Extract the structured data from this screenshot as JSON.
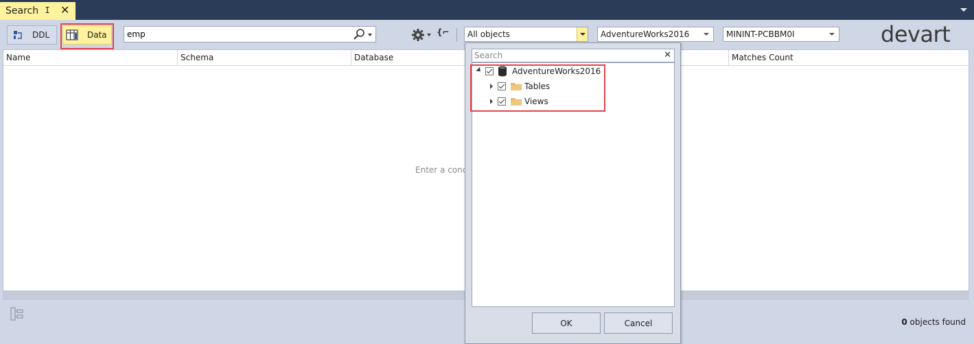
{
  "window": {
    "tab_title": "Search",
    "pin_glyph": "ⵊ",
    "close_glyph": "✕"
  },
  "toolbar": {
    "ddl_label": "DDL",
    "data_label": "Data",
    "search_value": "emp",
    "object_filter": "All objects",
    "database": "AdventureWorks2016",
    "server": "MININT-PCBBM0I",
    "brace_glyph": "{⌐"
  },
  "brand": {
    "logo_text": "devart"
  },
  "grid": {
    "columns": [
      "Name",
      "Schema",
      "Database",
      "Matches Count"
    ],
    "empty_message": "Enter a cond"
  },
  "popup": {
    "search_placeholder": "Search",
    "clear_glyph": "✕",
    "tree": [
      {
        "label": "AdventureWorks2016",
        "expanded": true,
        "checked": true,
        "icon": "database-icon"
      },
      {
        "label": "Tables",
        "expanded": false,
        "checked": true,
        "icon": "folder-icon"
      },
      {
        "label": "Views",
        "expanded": false,
        "checked": true,
        "icon": "folder-icon"
      }
    ],
    "ok_label": "OK",
    "cancel_label": "Cancel"
  },
  "status": {
    "count": "0",
    "suffix": " objects found"
  },
  "colors": {
    "titlebar": "#2b3c59",
    "active_tab": "#fff29d",
    "highlight": "#e3434a",
    "toolbar_bg": "#cfd6e5"
  }
}
